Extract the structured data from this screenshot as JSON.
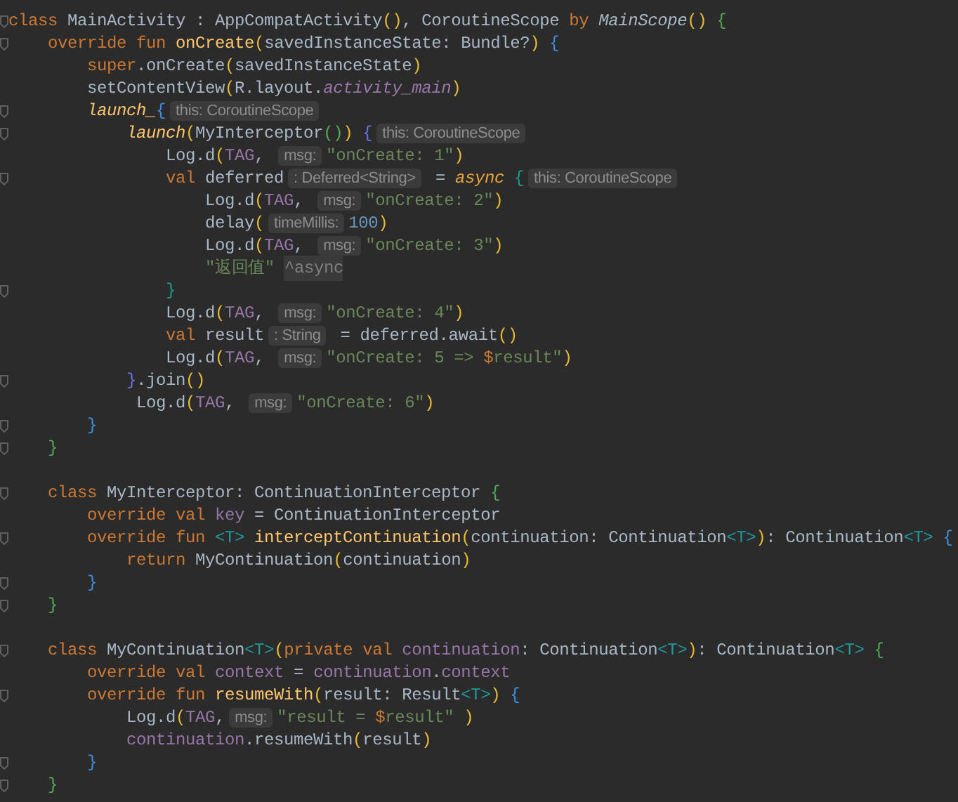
{
  "editor": {
    "lines": [
      {
        "fold": true,
        "tokens": [
          {
            "kind": "keyword",
            "text": "class "
          },
          {
            "kind": "plain",
            "text": "MainActivity : AppCompatActivity"
          },
          {
            "kind": "paren",
            "text": "()"
          },
          {
            "kind": "plain",
            "text": ", CoroutineScope "
          },
          {
            "kind": "keyword",
            "text": "by "
          },
          {
            "kind": "italic",
            "text": "MainScope"
          },
          {
            "kind": "paren",
            "text": "()"
          },
          {
            "kind": "brace_green",
            "text": " {"
          }
        ]
      },
      {
        "fold": true,
        "tokens": [
          {
            "kind": "keyword",
            "text": "    override fun "
          },
          {
            "kind": "function",
            "text": "onCreate"
          },
          {
            "kind": "paren",
            "text": "("
          },
          {
            "kind": "plain",
            "text": "savedInstanceState: Bundle?"
          },
          {
            "kind": "paren",
            "text": ")"
          },
          {
            "kind": "brace_blue",
            "text": " {"
          }
        ]
      },
      {
        "fold": false,
        "tokens": [
          {
            "kind": "keyword",
            "text": "        super"
          },
          {
            "kind": "plain",
            "text": ".onCreate"
          },
          {
            "kind": "paren",
            "text": "("
          },
          {
            "kind": "plain",
            "text": "savedInstanceState"
          },
          {
            "kind": "paren",
            "text": ")"
          }
        ]
      },
      {
        "fold": false,
        "tokens": [
          {
            "kind": "plain",
            "text": "        setContentView"
          },
          {
            "kind": "paren",
            "text": "("
          },
          {
            "kind": "plain",
            "text": "R.layout."
          },
          {
            "kind": "property_italic",
            "text": "activity_main"
          },
          {
            "kind": "paren",
            "text": ")"
          }
        ]
      },
      {
        "fold": true,
        "tokens": [
          {
            "kind": "extension",
            "text": "        launch_"
          },
          {
            "kind": "brace_blue",
            "text": "{"
          },
          {
            "kind": "hint",
            "text": "this: CoroutineScope"
          }
        ]
      },
      {
        "fold": true,
        "tokens": [
          {
            "kind": "extension",
            "text": "            launch"
          },
          {
            "kind": "paren",
            "text": "("
          },
          {
            "kind": "plain",
            "text": "MyInterceptor"
          },
          {
            "kind": "paren_green",
            "text": "()"
          },
          {
            "kind": "paren",
            "text": ")"
          },
          {
            "kind": "brace_indigo",
            "text": " {"
          },
          {
            "kind": "hint",
            "text": "this: CoroutineScope"
          }
        ]
      },
      {
        "fold": false,
        "tokens": [
          {
            "kind": "plain",
            "text": "                Log.d"
          },
          {
            "kind": "paren",
            "text": "("
          },
          {
            "kind": "property",
            "text": "TAG"
          },
          {
            "kind": "plain",
            "text": ", "
          },
          {
            "kind": "hint",
            "text": "msg:"
          },
          {
            "kind": "string",
            "text": "\"onCreate: 1\""
          },
          {
            "kind": "paren",
            "text": ")"
          }
        ]
      },
      {
        "fold": true,
        "tokens": [
          {
            "kind": "keyword",
            "text": "                val "
          },
          {
            "kind": "plain",
            "text": "deferred"
          },
          {
            "kind": "hint",
            "text": ": Deferred<String>"
          },
          {
            "kind": "plain",
            "text": " = "
          },
          {
            "kind": "extension_orange",
            "text": "async"
          },
          {
            "kind": "brace_teal",
            "text": " {"
          },
          {
            "kind": "hint",
            "text": "this: CoroutineScope"
          }
        ]
      },
      {
        "fold": false,
        "tokens": [
          {
            "kind": "plain",
            "text": "                    Log.d"
          },
          {
            "kind": "paren",
            "text": "("
          },
          {
            "kind": "property",
            "text": "TAG"
          },
          {
            "kind": "plain",
            "text": ", "
          },
          {
            "kind": "hint",
            "text": "msg:"
          },
          {
            "kind": "string",
            "text": "\"onCreate: 2\""
          },
          {
            "kind": "paren",
            "text": ")"
          }
        ]
      },
      {
        "fold": false,
        "tokens": [
          {
            "kind": "plain",
            "text": "                    delay"
          },
          {
            "kind": "paren",
            "text": "("
          },
          {
            "kind": "hint",
            "text": "timeMillis:"
          },
          {
            "kind": "number",
            "text": "100"
          },
          {
            "kind": "paren",
            "text": ")"
          }
        ]
      },
      {
        "fold": false,
        "tokens": [
          {
            "kind": "plain",
            "text": "                    Log.d"
          },
          {
            "kind": "paren",
            "text": "("
          },
          {
            "kind": "property",
            "text": "TAG"
          },
          {
            "kind": "plain",
            "text": ", "
          },
          {
            "kind": "hint",
            "text": "msg:"
          },
          {
            "kind": "string",
            "text": "\"onCreate: 3\""
          },
          {
            "kind": "paren",
            "text": ")"
          }
        ]
      },
      {
        "fold": false,
        "tokens": [
          {
            "kind": "string",
            "text": "                    \"返回值\" "
          },
          {
            "kind": "label",
            "text": "^async"
          }
        ]
      },
      {
        "fold": true,
        "tokens": [
          {
            "kind": "brace_teal",
            "text": "                }"
          }
        ]
      },
      {
        "fold": false,
        "tokens": [
          {
            "kind": "plain",
            "text": "                Log.d"
          },
          {
            "kind": "paren",
            "text": "("
          },
          {
            "kind": "property",
            "text": "TAG"
          },
          {
            "kind": "plain",
            "text": ", "
          },
          {
            "kind": "hint",
            "text": "msg:"
          },
          {
            "kind": "string",
            "text": "\"onCreate: 4\""
          },
          {
            "kind": "paren",
            "text": ")"
          }
        ]
      },
      {
        "fold": false,
        "tokens": [
          {
            "kind": "keyword",
            "text": "                val "
          },
          {
            "kind": "plain",
            "text": "result"
          },
          {
            "kind": "hint",
            "text": ": String"
          },
          {
            "kind": "plain",
            "text": " = deferred.await"
          },
          {
            "kind": "paren",
            "text": "()"
          }
        ]
      },
      {
        "fold": false,
        "tokens": [
          {
            "kind": "plain",
            "text": "                Log.d"
          },
          {
            "kind": "paren",
            "text": "("
          },
          {
            "kind": "property",
            "text": "TAG"
          },
          {
            "kind": "plain",
            "text": ", "
          },
          {
            "kind": "hint",
            "text": "msg:"
          },
          {
            "kind": "string",
            "text": "\"onCreate: 5 => "
          },
          {
            "kind": "keyword",
            "text": "$"
          },
          {
            "kind": "string",
            "text": "result\""
          },
          {
            "kind": "paren",
            "text": ")"
          }
        ]
      },
      {
        "fold": true,
        "tokens": [
          {
            "kind": "brace_indigo",
            "text": "            }"
          },
          {
            "kind": "plain",
            "text": ".join"
          },
          {
            "kind": "paren",
            "text": "()"
          }
        ]
      },
      {
        "fold": false,
        "tokens": [
          {
            "kind": "plain",
            "text": "             Log.d"
          },
          {
            "kind": "paren",
            "text": "("
          },
          {
            "kind": "property",
            "text": "TAG"
          },
          {
            "kind": "plain",
            "text": ", "
          },
          {
            "kind": "hint",
            "text": "msg:"
          },
          {
            "kind": "string",
            "text": "\"onCreate: 6\""
          },
          {
            "kind": "paren",
            "text": ")"
          }
        ]
      },
      {
        "fold": true,
        "tokens": [
          {
            "kind": "brace_blue",
            "text": "        }"
          }
        ]
      },
      {
        "fold": true,
        "tokens": [
          {
            "kind": "brace_green",
            "text": "    }"
          }
        ]
      },
      {
        "fold": false
      },
      {
        "fold": true,
        "tokens": [
          {
            "kind": "keyword",
            "text": "    class "
          },
          {
            "kind": "plain",
            "text": "MyInterceptor: ContinuationInterceptor "
          },
          {
            "kind": "brace_green",
            "text": "{"
          }
        ]
      },
      {
        "fold": false,
        "tokens": [
          {
            "kind": "keyword",
            "text": "        override val "
          },
          {
            "kind": "property",
            "text": "key"
          },
          {
            "kind": "plain",
            "text": " = ContinuationInterceptor"
          }
        ]
      },
      {
        "fold": true,
        "tokens": [
          {
            "kind": "keyword",
            "text": "        override fun "
          },
          {
            "kind": "type_param",
            "text": "<T>"
          },
          {
            "kind": "function",
            "text": " interceptContinuation"
          },
          {
            "kind": "paren",
            "text": "("
          },
          {
            "kind": "plain",
            "text": "continuation: Continuation"
          },
          {
            "kind": "type_param",
            "text": "<T>"
          },
          {
            "kind": "paren",
            "text": ")"
          },
          {
            "kind": "plain",
            "text": ": Continuation"
          },
          {
            "kind": "type_param",
            "text": "<T>"
          },
          {
            "kind": "brace_blue",
            "text": " {"
          }
        ]
      },
      {
        "fold": false,
        "tokens": [
          {
            "kind": "keyword",
            "text": "            return "
          },
          {
            "kind": "plain",
            "text": "MyContinuation"
          },
          {
            "kind": "paren",
            "text": "("
          },
          {
            "kind": "plain",
            "text": "continuation"
          },
          {
            "kind": "paren",
            "text": ")"
          }
        ]
      },
      {
        "fold": true,
        "tokens": [
          {
            "kind": "brace_blue",
            "text": "        }"
          }
        ]
      },
      {
        "fold": true,
        "tokens": [
          {
            "kind": "brace_green",
            "text": "    }"
          }
        ]
      },
      {
        "fold": false
      },
      {
        "fold": true,
        "tokens": [
          {
            "kind": "keyword",
            "text": "    class "
          },
          {
            "kind": "plain",
            "text": "MyContinuation"
          },
          {
            "kind": "type_param",
            "text": "<T>"
          },
          {
            "kind": "paren",
            "text": "("
          },
          {
            "kind": "keyword",
            "text": "private val "
          },
          {
            "kind": "property",
            "text": "continuation"
          },
          {
            "kind": "plain",
            "text": ": Continuation"
          },
          {
            "kind": "type_param",
            "text": "<T>"
          },
          {
            "kind": "paren",
            "text": ")"
          },
          {
            "kind": "plain",
            "text": ": Continuation"
          },
          {
            "kind": "type_param",
            "text": "<T>"
          },
          {
            "kind": "brace_green",
            "text": " {"
          }
        ]
      },
      {
        "fold": false,
        "tokens": [
          {
            "kind": "keyword",
            "text": "        override val "
          },
          {
            "kind": "property",
            "text": "context"
          },
          {
            "kind": "plain",
            "text": " = "
          },
          {
            "kind": "property",
            "text": "continuation"
          },
          {
            "kind": "plain",
            "text": "."
          },
          {
            "kind": "property",
            "text": "context"
          }
        ]
      },
      {
        "fold": true,
        "tokens": [
          {
            "kind": "keyword",
            "text": "        override fun "
          },
          {
            "kind": "function",
            "text": "resumeWith"
          },
          {
            "kind": "paren",
            "text": "("
          },
          {
            "kind": "plain",
            "text": "result: Result"
          },
          {
            "kind": "type_param",
            "text": "<T>"
          },
          {
            "kind": "paren",
            "text": ")"
          },
          {
            "kind": "brace_blue",
            "text": " {"
          }
        ]
      },
      {
        "fold": false,
        "tokens": [
          {
            "kind": "plain",
            "text": "            Log.d"
          },
          {
            "kind": "paren",
            "text": "("
          },
          {
            "kind": "property",
            "text": "TAG"
          },
          {
            "kind": "plain",
            "text": ","
          },
          {
            "kind": "hint",
            "text": "msg:"
          },
          {
            "kind": "string",
            "text": "\"result = "
          },
          {
            "kind": "keyword",
            "text": "$"
          },
          {
            "kind": "string",
            "text": "result\""
          },
          {
            "kind": "paren",
            "text": " )"
          }
        ]
      },
      {
        "fold": false,
        "tokens": [
          {
            "kind": "property",
            "text": "            continuation"
          },
          {
            "kind": "plain",
            "text": ".resumeWith"
          },
          {
            "kind": "paren",
            "text": "("
          },
          {
            "kind": "plain",
            "text": "result"
          },
          {
            "kind": "paren",
            "text": ")"
          }
        ]
      },
      {
        "fold": true,
        "tokens": [
          {
            "kind": "brace_blue",
            "text": "        }"
          }
        ]
      },
      {
        "fold": true,
        "tokens": [
          {
            "kind": "brace_green",
            "text": "    }"
          }
        ]
      }
    ]
  }
}
